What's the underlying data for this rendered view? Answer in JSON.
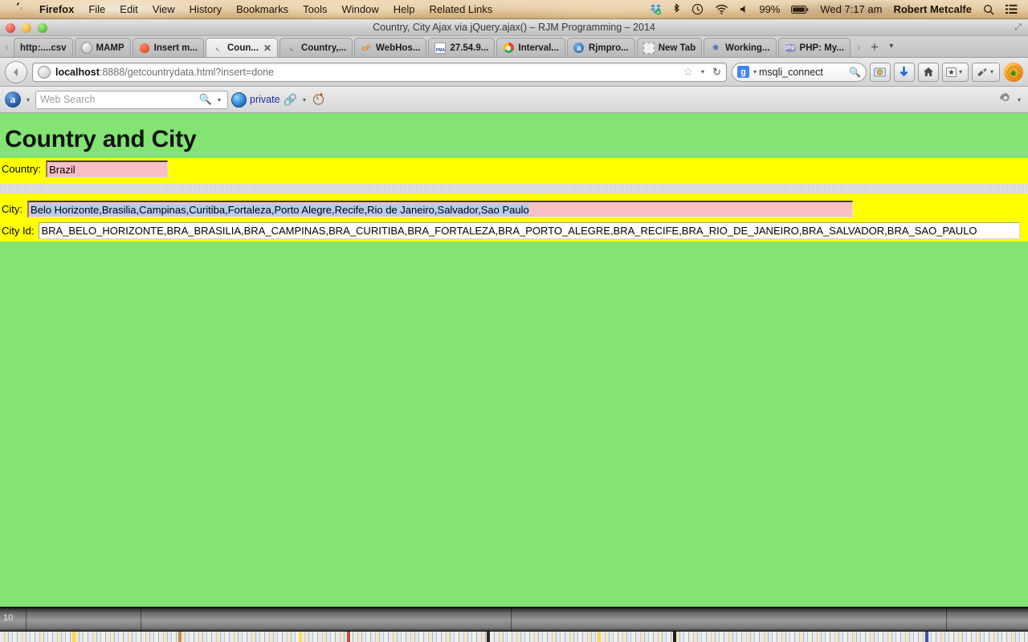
{
  "menubar": {
    "apple": "apple-logo",
    "items": [
      {
        "label": "Firefox",
        "bold": true
      },
      {
        "label": "File",
        "bold": false
      },
      {
        "label": "Edit",
        "bold": false
      },
      {
        "label": "View",
        "bold": false
      },
      {
        "label": "History",
        "bold": false
      },
      {
        "label": "Bookmarks",
        "bold": false
      },
      {
        "label": "Tools",
        "bold": false
      },
      {
        "label": "Window",
        "bold": false
      },
      {
        "label": "Help",
        "bold": false
      },
      {
        "label": "Related Links",
        "bold": false
      }
    ],
    "status": {
      "dropbox_icon": "dropbox-icon",
      "bluetooth_icon": "bluetooth-icon",
      "timemachine_icon": "time-machine-icon",
      "wifi_icon": "wifi-icon",
      "volume_icon": "volume-icon",
      "battery_percent": "99%",
      "battery_icon": "battery-icon",
      "clock": "Wed 7:17 am",
      "user": "Robert Metcalfe",
      "spotlight_icon": "search-icon",
      "notification_icon": "notification-center-icon"
    }
  },
  "window": {
    "title": "Country, City Ajax via jQuery.ajax() – RJM Programming – 2014",
    "fullscreen_icon": "fullscreen-icon"
  },
  "tabs": {
    "scroll_left": "‹",
    "scroll_right": "›",
    "add_label": "+",
    "list_label": "▾",
    "close_label": "✕",
    "items": [
      {
        "label": "http:....csv",
        "icon": "none",
        "active": false
      },
      {
        "label": "MAMP",
        "icon": "globe",
        "active": false
      },
      {
        "label": "Insert m...",
        "icon": "apple",
        "active": false
      },
      {
        "label": "Coun...",
        "icon": "swirl",
        "active": true
      },
      {
        "label": "Country,...",
        "icon": "swirl",
        "active": false
      },
      {
        "label": "WebHos...",
        "icon": "cp",
        "active": false
      },
      {
        "label": "27.54.9...",
        "icon": "pma",
        "active": false
      },
      {
        "label": "Interval...",
        "icon": "chrome",
        "active": false
      },
      {
        "label": "Rjmpro...",
        "icon": "rjm",
        "active": false
      },
      {
        "label": "New Tab",
        "icon": "dotted",
        "active": false
      },
      {
        "label": "Working...",
        "icon": "sea",
        "active": false
      },
      {
        "label": "PHP: My...",
        "icon": "php",
        "active": false
      }
    ]
  },
  "navbar": {
    "back_icon": "back-arrow-icon",
    "site_icon": "site-identity-icon",
    "url_host": "localhost",
    "url_rest": ":8888/getcountrydata.html?insert=done",
    "bookmark_icon": "star-icon",
    "bookmark_caret": "▾",
    "reload_icon": "↻",
    "search_engine_badge": "g",
    "search_engine_caret": "▾",
    "search_value": "msqli_connect",
    "search_submit_icon": "search-icon",
    "buttons": [
      {
        "name": "screenshot-button",
        "glyph": "🖼"
      },
      {
        "name": "download-button",
        "glyph": "⬇"
      },
      {
        "name": "home-button",
        "glyph": "⌂"
      },
      {
        "name": "bookmarks-menu-button",
        "glyph": "★"
      },
      {
        "name": "addon-button",
        "glyph": "✎"
      }
    ],
    "firefox_button": "firefox-button"
  },
  "toolbar2": {
    "alexa_icon": "alexa-toolbar-icon",
    "alexa_caret": "▾",
    "search_placeholder": "Web Search",
    "search_value": "",
    "search_icon": "search-icon",
    "search_caret": "▾",
    "globe_icon": "globe-icon",
    "private_label": "private",
    "chain_icon": "link-icon",
    "chain_caret": "▾",
    "stamp_icon": "stamp-icon",
    "settings_icon": "gear-icon",
    "settings_caret": "▾"
  },
  "page": {
    "heading": "Country and City",
    "country_label": "Country:",
    "country_value": "Brazil",
    "city_label": "City:",
    "city_value_selected": "Belo Horizonte,Brasilia,Campinas,Curitiba,Fortaleza,Porto Alegre,Recife,Rio de Janeiro,Salvador,Sao Paulo",
    "city_id_label": "City Id:",
    "city_id_value": "BRA_BELO_HORIZONTE,BRA_BRASILIA,BRA_CAMPINAS,BRA_CURITIBA,BRA_FORTALEZA,BRA_PORTO_ALEGRE,BRA_RECIFE,BRA_RIO_DE_JANEIRO,BRA_SALVADOR,BRA_SAO_PAULO",
    "colors": {
      "page_background": "#83e373",
      "form_background": "#ffff00",
      "input_background": "#f7bfc4",
      "selection_background": "#b6cdf0",
      "readonly_background": "#ffffff"
    }
  },
  "dock": {
    "label": "10"
  }
}
